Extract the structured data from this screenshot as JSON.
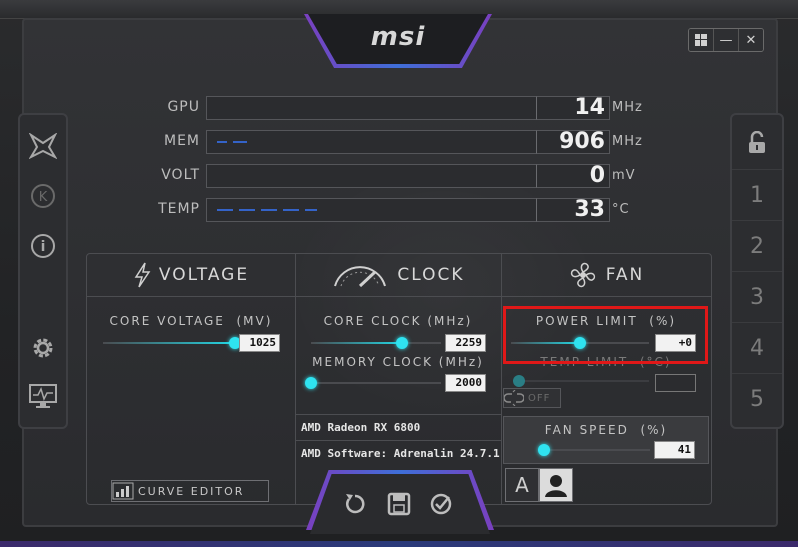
{
  "brand": {
    "logo_text": "msi"
  },
  "window_controls": {
    "windows_icon": "windows-icon",
    "minimize": "—",
    "close": "✕"
  },
  "left_sidebar": [
    {
      "icon": "dragon-oc-icon"
    },
    {
      "icon": "k-boost-icon",
      "text": "K"
    },
    {
      "icon": "info-icon",
      "text": "i"
    },
    {
      "icon": "settings-gear-icon"
    },
    {
      "icon": "monitoring-icon"
    }
  ],
  "right_sidebar": {
    "lock_icon": "unlock-icon",
    "profiles": [
      "1",
      "2",
      "3",
      "4",
      "5"
    ]
  },
  "monitor": {
    "rows": [
      {
        "label": "GPU",
        "value": "14",
        "unit": "MHz",
        "fill": 0
      },
      {
        "label": "MEM",
        "value": "906",
        "unit": "MHz",
        "fill": 0.1
      },
      {
        "label": "VOLT",
        "value": "0",
        "unit": "mV",
        "fill": 0
      },
      {
        "label": "TEMP",
        "value": "33",
        "unit": "°C",
        "fill": 0.33
      }
    ]
  },
  "voltage": {
    "title": "VOLTAGE",
    "core_voltage_label": "CORE VOLTAGE",
    "core_voltage_unit": "(MV)",
    "core_voltage_value": "1025",
    "core_voltage_level": 1.0,
    "curve_editor_label": "CURVE EDITOR"
  },
  "clock": {
    "title": "CLOCK",
    "core_clock_label": "CORE CLOCK",
    "core_clock_unit": "(MHz)",
    "core_clock_value": "2259",
    "core_clock_level": 0.7,
    "memory_clock_label": "MEMORY CLOCK",
    "memory_clock_unit": "(MHz)",
    "memory_clock_value": "2000",
    "memory_clock_level": 0.0,
    "gpu_name": "AMD Radeon RX 6800",
    "software": "AMD Software: Adrenalin 24.7.1"
  },
  "fan": {
    "title": "FAN",
    "power_limit_label": "POWER LIMIT",
    "power_limit_unit": "(%)",
    "power_limit_value": "+0",
    "power_limit_level": 0.5,
    "temp_limit_label": "TEMP LIMIT",
    "temp_limit_unit": "(°C)",
    "temp_limit_value": "",
    "link_off_label": "OFF",
    "fan_speed_label": "FAN SPEED",
    "fan_speed_unit": "(%)",
    "fan_speed_value": "41",
    "fan_speed_level": 0.0,
    "auto_mode_label": "A",
    "user_mode_icon": "user-icon"
  },
  "actions": [
    {
      "icon": "reset-icon"
    },
    {
      "icon": "save-icon"
    },
    {
      "icon": "apply-icon"
    }
  ],
  "colors": {
    "accent": "#22d6e4",
    "highlight": "#e01818",
    "monitor_bar": "#3463c8"
  }
}
